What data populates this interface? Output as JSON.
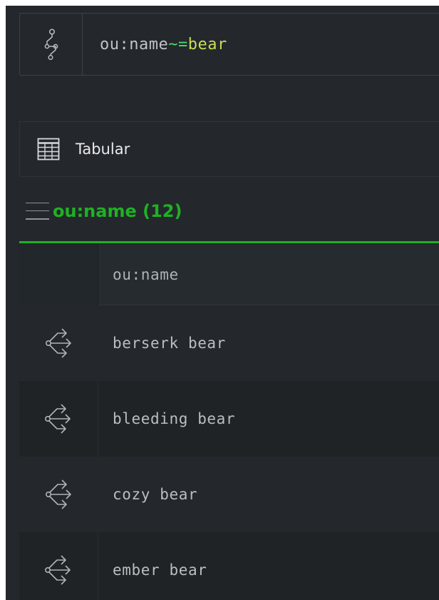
{
  "query": {
    "field": "ou:name",
    "operator": "~=",
    "value": "bear"
  },
  "icons": {
    "query": "storm-query-icon",
    "tabular": "table-grid-icon",
    "menu": "hamburger-menu-icon",
    "row": "node-explore-icon"
  },
  "colors": {
    "background": "#24282c",
    "accent_green": "#1fb124",
    "operator_green": "#4dd96a",
    "value_yellow_green": "#c6dd55"
  },
  "view": {
    "mode_label": "Tabular"
  },
  "results": {
    "title": "ou:name (12)",
    "column_header": "ou:name",
    "rows": [
      {
        "name": "berserk bear"
      },
      {
        "name": "bleeding bear"
      },
      {
        "name": "cozy bear"
      },
      {
        "name": "ember bear"
      }
    ]
  }
}
